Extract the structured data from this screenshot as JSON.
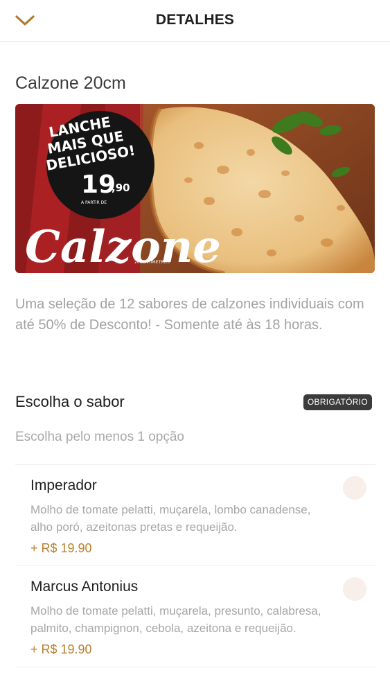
{
  "header": {
    "title": "DETALHES",
    "back_icon": "chevron-down-icon"
  },
  "product": {
    "name": "Calzone 20cm",
    "banner": {
      "headline_lines": [
        "LANCHE",
        "MAIS QUE",
        "DELICIOSO!"
      ],
      "price_prefix": "A PARTIR DE",
      "price_main": "19",
      "price_cents": ",90",
      "brand": "Calzone",
      "brand_sub": "20CENTÍMETROS"
    },
    "description": "Uma seleção de 12 sabores de calzones individuais com até 50% de Desconto! - Somente até às 18 horas."
  },
  "section": {
    "title": "Escolha o sabor",
    "badge": "OBRIGATÓRIO",
    "subtitle": "Escolha pelo menos 1 opção"
  },
  "options": [
    {
      "name": "Imperador",
      "description": "Molho de tomate pelatti, muçarela, lombo canadense, alho poró, azeitonas pretas e requeijão.",
      "price": "+ R$ 19.90"
    },
    {
      "name": "Marcus Antonius",
      "description": "Molho de tomate pelatti, muçarela, presunto, calabresa, palmito, champignon, cebola, azeitona e requeijão.",
      "price": "+ R$ 19.90"
    }
  ],
  "colors": {
    "accent": "#b8812f",
    "badge_bg": "#3b3b3b",
    "radio_bg": "#f8eeea",
    "banner_red": "#8e1b1c"
  }
}
